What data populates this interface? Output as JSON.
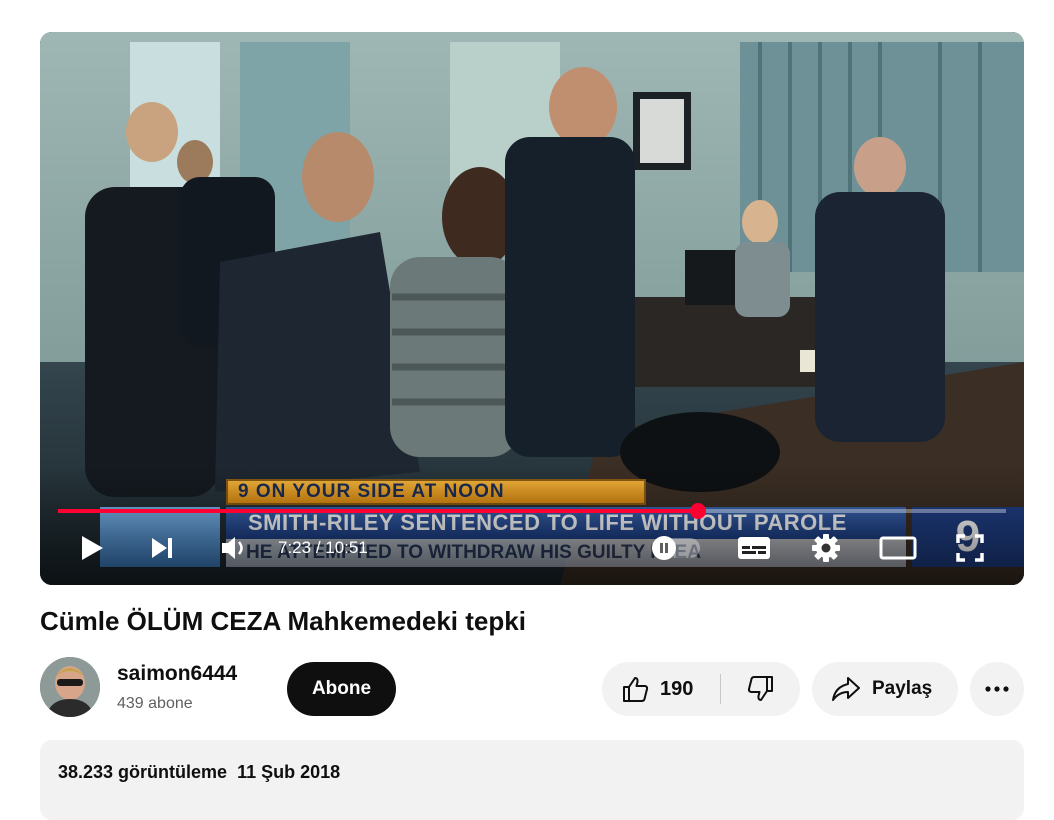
{
  "player": {
    "current_time": "7:23",
    "separator": " / ",
    "duration": "10:51",
    "progress": 0.675,
    "chyron_top": "9 ON YOUR SIDE AT NOON",
    "chyron_main": "SMITH-RILEY SENTENCED TO LIFE WITHOUT PAROLE",
    "chyron_sub": "HE ATTEMPTED TO WITHDRAW HIS GUILTY PLEA",
    "station_logo": "9",
    "accent_color": "#ff0033",
    "icons": [
      "play-icon",
      "next-icon",
      "volume-icon",
      "autoplay-toggle",
      "subtitles-icon",
      "settings-gear-icon",
      "theater-mode-icon",
      "fullscreen-icon"
    ]
  },
  "video": {
    "title": "Cümle ÖLÜM CEZA Mahkemedeki tepki"
  },
  "channel": {
    "name": "saimon6444",
    "subscribers": "439 abone",
    "subscribe_label": "Abone"
  },
  "actions": {
    "like_count": "190",
    "share_label": "Paylaş"
  },
  "description": {
    "views": "38.233 görüntüleme",
    "date": "11 Şub 2018"
  }
}
